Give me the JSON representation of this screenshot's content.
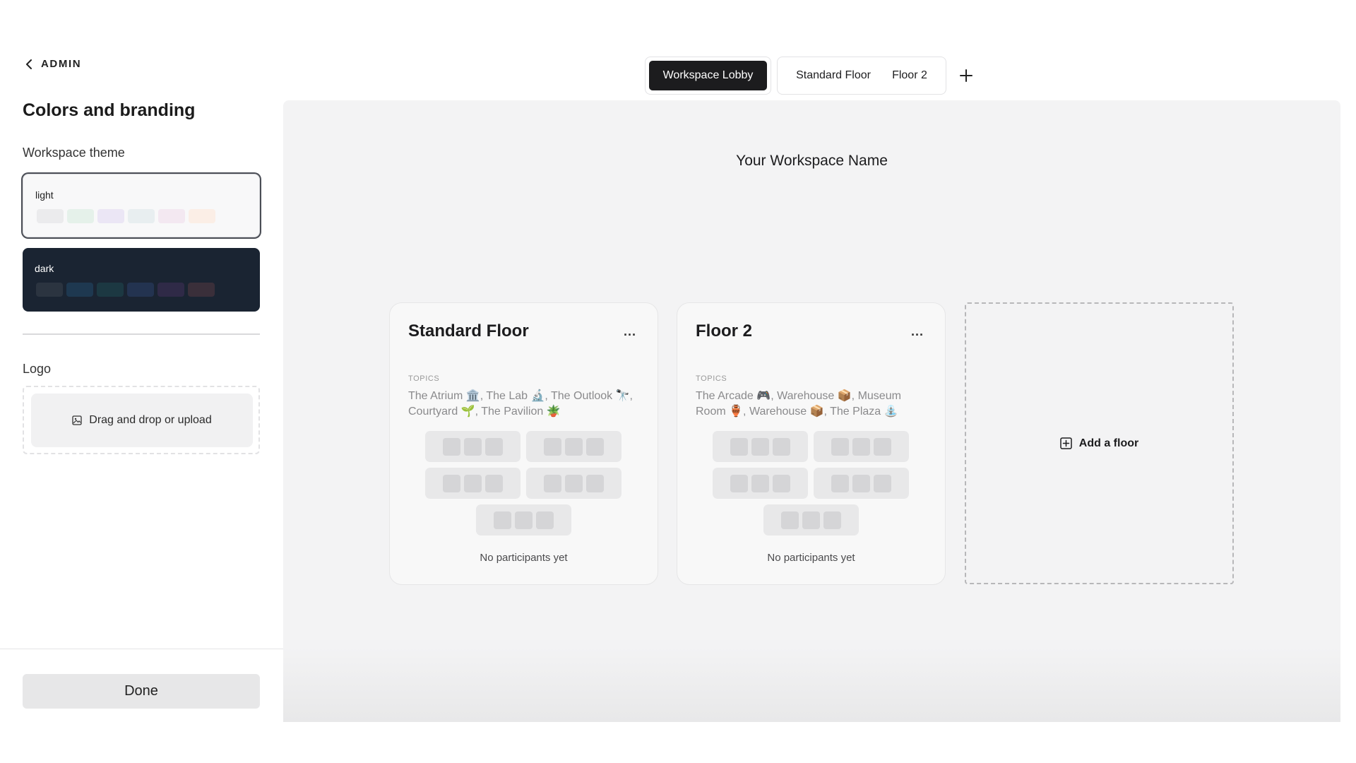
{
  "sidebar": {
    "back_label": "ADMIN",
    "title": "Colors and branding",
    "theme_section_label": "Workspace theme",
    "themes": [
      {
        "name": "light",
        "selected": true,
        "swatches": [
          "#ebebed",
          "#e5f1ea",
          "#ebe6f5",
          "#e8eef0",
          "#f3e8f1",
          "#fbeee6"
        ]
      },
      {
        "name": "dark",
        "selected": false,
        "swatches": [
          "#2b3440",
          "#1e3850",
          "#1c3842",
          "#233350",
          "#2f2a47",
          "#3a2f3a"
        ]
      }
    ],
    "logo_section_label": "Logo",
    "upload_label": "Drag and drop or upload",
    "done_label": "Done"
  },
  "tabs": {
    "active": "Workspace Lobby",
    "others": [
      "Standard Floor",
      "Floor 2"
    ]
  },
  "canvas": {
    "workspace_name": "Your Workspace Name",
    "floors": [
      {
        "title": "Standard Floor",
        "more_label": "...",
        "topics_label": "TOPICS",
        "topics": "The Atrium 🏛️, The Lab 🔬, The Outlook 🔭, Courtyard 🌱, The Pavilion 🪴",
        "empty_label": "No participants yet"
      },
      {
        "title": "Floor 2",
        "more_label": "...",
        "topics_label": "TOPICS",
        "topics": "The Arcade 🎮, Warehouse 📦, Museum Room 🏺, Warehouse 📦, The Plaza ⛲",
        "empty_label": "No participants yet"
      }
    ],
    "add_floor_label": "Add a floor"
  },
  "icons": {
    "back": "chevron-left-icon",
    "upload": "image-icon",
    "add_tab": "plus-icon",
    "add_floor": "plus-square-icon"
  }
}
